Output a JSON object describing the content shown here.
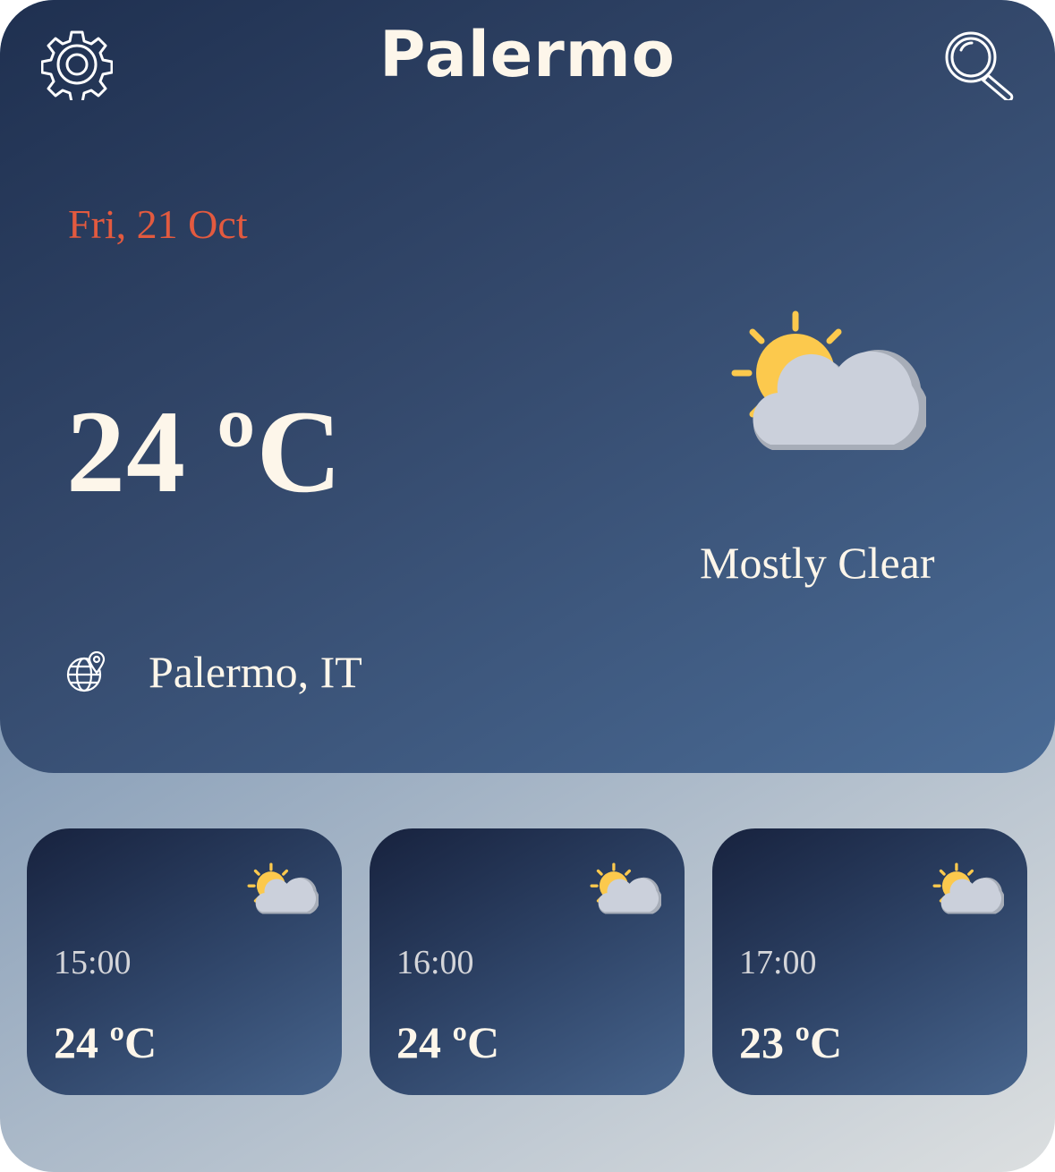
{
  "header": {
    "city": "Palermo"
  },
  "current": {
    "date": "Fri, 21 Oct",
    "temperature": "24 ºC",
    "condition": "Mostly Clear",
    "location": "Palermo, IT",
    "icon": "sun-behind-cloud-icon"
  },
  "hourly": [
    {
      "time": "15:00",
      "temperature": "24 ºC",
      "icon": "sun-behind-cloud-icon"
    },
    {
      "time": "16:00",
      "temperature": "24 ºC",
      "icon": "sun-behind-cloud-icon"
    },
    {
      "time": "17:00",
      "temperature": "23 ºC",
      "icon": "sun-behind-cloud-icon"
    }
  ],
  "colors": {
    "hero_top": "#1f3050",
    "hero_bottom": "#4a6b95",
    "date_accent": "#e35a3f",
    "text_light": "#fdf6ea",
    "sun": "#fcc94d",
    "cloud": "#cbd0db"
  }
}
